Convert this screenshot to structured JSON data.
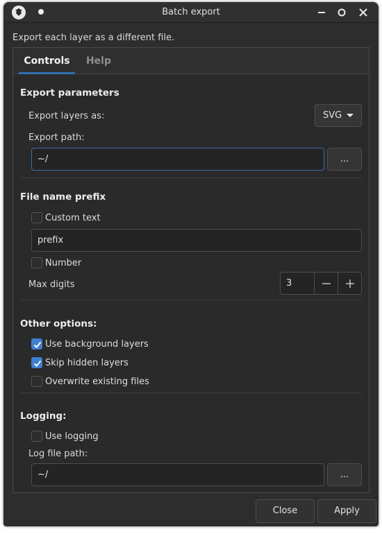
{
  "window": {
    "title": "Batch export",
    "icons": [
      "app-icon",
      "sticky-dot-icon",
      "minimize-icon",
      "maximize-icon",
      "close-icon"
    ]
  },
  "description": "Export each layer as a different file.",
  "tabs": [
    {
      "label": "Controls",
      "active": true
    },
    {
      "label": "Help",
      "active": false
    }
  ],
  "export_parameters": {
    "title": "Export parameters",
    "export_as_label": "Export layers as:",
    "format_value": "SVG",
    "path_label": "Export path:",
    "path_value": "~/",
    "browse_label": "..."
  },
  "file_name_prefix": {
    "title": "File name prefix",
    "custom_text_label": "Custom text",
    "custom_text_checked": false,
    "prefix_value": "prefix",
    "number_label": "Number",
    "number_checked": false,
    "max_digits_label": "Max digits",
    "max_digits_value": "3"
  },
  "other_options": {
    "title": "Other options:",
    "items": [
      {
        "label": "Use background layers",
        "checked": true
      },
      {
        "label": "Skip hidden layers",
        "checked": true
      },
      {
        "label": "Overwrite existing files",
        "checked": false
      }
    ]
  },
  "logging": {
    "title": "Logging:",
    "use_logging_label": "Use logging",
    "use_logging_checked": false,
    "log_path_label": "Log file path:",
    "log_path_value": "~/",
    "browse_label": "..."
  },
  "footer": {
    "close_label": "Close",
    "apply_label": "Apply"
  },
  "colors": {
    "accent": "#3f7fd0",
    "background": "#2d2d2d"
  }
}
